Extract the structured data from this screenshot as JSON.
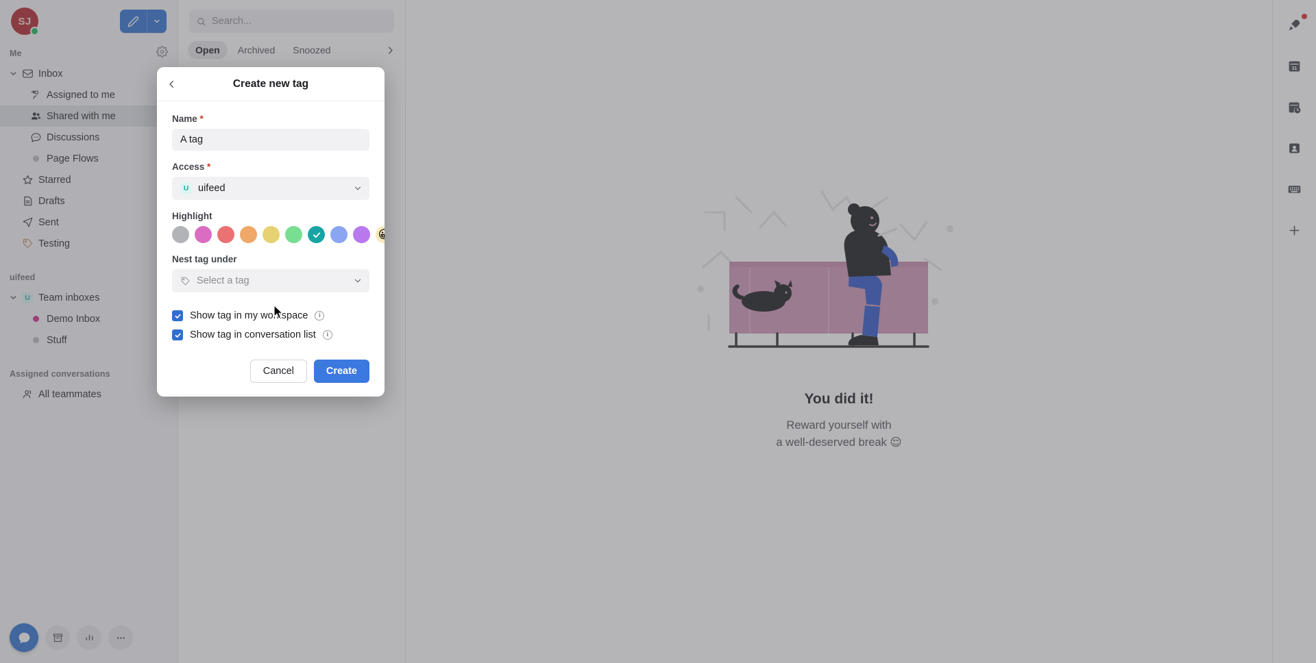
{
  "app": {
    "accent_color": "#2f6fd0",
    "sidebar_bg": "#f6f6f7",
    "scrim_color": "rgba(90,92,97,0.45)"
  },
  "sidebar": {
    "avatar": {
      "initials": "SJ",
      "bg_color": "#b3242a",
      "presence_color": "#17b45a"
    },
    "compose": {
      "icon": "pencil-icon",
      "caret_icon": "chevron-down-icon"
    },
    "sections": [
      {
        "title": "Me",
        "has_settings_gear": true,
        "items": [
          {
            "label": "Inbox",
            "icon": "inbox-icon",
            "level": 0,
            "expanded": true,
            "active": false
          },
          {
            "label": "Assigned to me",
            "icon": "assigned-person-icon",
            "level": 1,
            "active": false
          },
          {
            "label": "Shared with me",
            "icon": "people-icon",
            "level": 1,
            "active": true
          },
          {
            "label": "Discussions",
            "icon": "chat-bubble-icon",
            "level": 1,
            "active": false
          },
          {
            "label": "Page Flows",
            "icon": "dot-icon",
            "level": 1,
            "active": false,
            "dot_color": "#b9bbc0"
          },
          {
            "label": "Starred",
            "icon": "star-icon",
            "level": 0,
            "active": false
          },
          {
            "label": "Drafts",
            "icon": "document-icon",
            "level": 0,
            "active": false
          },
          {
            "label": "Sent",
            "icon": "send-icon",
            "level": 0,
            "active": false
          },
          {
            "label": "Testing",
            "icon": "tag-icon",
            "level": 0,
            "active": false,
            "icon_color": "#c98f5e"
          }
        ]
      },
      {
        "title": "uifeed",
        "has_settings_gear": false,
        "items": [
          {
            "label": "Team inboxes",
            "icon": "workspace-badge-icon",
            "level": 0,
            "expanded": true,
            "badge_letter": "U",
            "active": false
          },
          {
            "label": "Demo Inbox",
            "icon": "dot-icon",
            "level": 1,
            "active": false,
            "dot_color": "#cf2b8f"
          },
          {
            "label": "Stuff",
            "icon": "dot-icon",
            "level": 1,
            "active": false,
            "dot_color": "#b9bbc0"
          }
        ]
      },
      {
        "title": "Assigned conversations",
        "has_settings_gear": false,
        "items": [
          {
            "label": "All teammates",
            "icon": "teammates-icon",
            "level": 0,
            "active": false
          }
        ]
      }
    ],
    "dock": [
      {
        "name": "messenger-button",
        "icon": "chat-bubble-filled-icon",
        "style": "primary"
      },
      {
        "name": "inbox-shortcut-button",
        "icon": "archive-icon",
        "style": "ghost"
      },
      {
        "name": "reports-button",
        "icon": "bar-chart-icon",
        "style": "ghost"
      },
      {
        "name": "more-options-button",
        "icon": "ellipsis-icon",
        "style": "ghost"
      }
    ]
  },
  "list_column": {
    "search": {
      "placeholder": "Search...",
      "value": "",
      "icon": "search-icon"
    },
    "tabs": [
      {
        "label": "Open",
        "active": true
      },
      {
        "label": "Archived",
        "active": false
      },
      {
        "label": "Snoozed",
        "active": false
      }
    ],
    "more_tabs_icon": "chevron-right-icon"
  },
  "main": {
    "illustration": "person-on-couch-with-cat-illustration",
    "title": "You did it!",
    "subtitle_line1": "Reward yourself with",
    "subtitle_line2": "a well-deserved break 😌"
  },
  "right_rail": [
    {
      "name": "whats-new-button",
      "icon": "rocket-icon",
      "badge": true
    },
    {
      "name": "calendar-button",
      "icon": "calendar-31-icon",
      "badge": false
    },
    {
      "name": "snooze-button",
      "icon": "clock-calendar-icon",
      "badge": false
    },
    {
      "name": "contacts-button",
      "icon": "contact-card-icon",
      "badge": false
    },
    {
      "name": "shortcuts-button",
      "icon": "keyboard-icon",
      "badge": false
    },
    {
      "name": "add-app-button",
      "icon": "plus-icon",
      "badge": false
    }
  ],
  "modal": {
    "title": "Create new tag",
    "back_icon": "chevron-left-icon",
    "name": {
      "label": "Name",
      "required": true,
      "value": "A tag",
      "placeholder": ""
    },
    "access": {
      "label": "Access",
      "required": true,
      "value": "uifeed",
      "badge_letter": "U",
      "caret_icon": "chevron-down-icon"
    },
    "highlight": {
      "label": "Highlight",
      "selected_index": 6,
      "check_icon": "check-icon",
      "swatches": [
        {
          "name": "gray",
          "color": "#b2b3b6"
        },
        {
          "name": "pink",
          "color": "#da6dc2"
        },
        {
          "name": "red",
          "color": "#ea7272"
        },
        {
          "name": "orange",
          "color": "#f0a868"
        },
        {
          "name": "yellow",
          "color": "#e6d273"
        },
        {
          "name": "green",
          "color": "#78de92"
        },
        {
          "name": "teal",
          "color": "#18a4a4"
        },
        {
          "name": "blue",
          "color": "#8aa6f2"
        },
        {
          "name": "purple",
          "color": "#b879ee"
        },
        {
          "name": "emoji",
          "color": "#f6e8b8",
          "glyph": "😀"
        }
      ]
    },
    "nest": {
      "label": "Nest tag under",
      "placeholder": "Select a tag",
      "value": "",
      "icon": "tag-icon",
      "caret_icon": "chevron-down-icon"
    },
    "checkboxes": [
      {
        "label": "Show tag in my workspace",
        "checked": true,
        "info_icon": "info-icon"
      },
      {
        "label": "Show tag in conversation list",
        "checked": true,
        "info_icon": "info-icon"
      }
    ],
    "buttons": {
      "cancel": "Cancel",
      "create": "Create"
    }
  }
}
